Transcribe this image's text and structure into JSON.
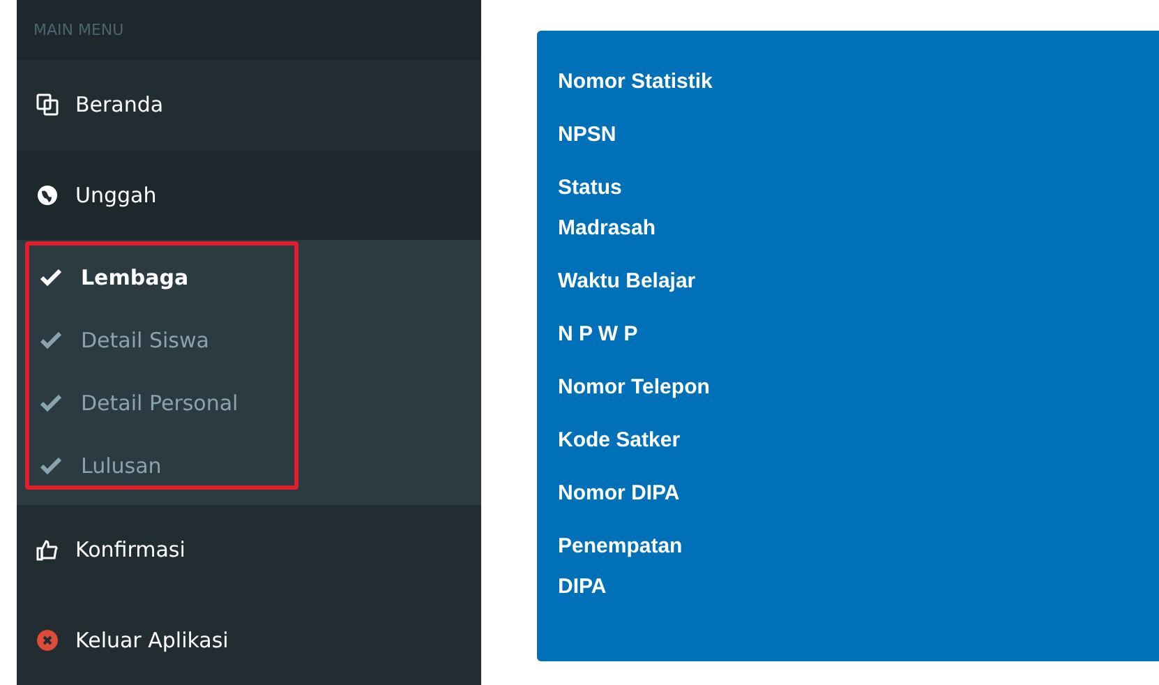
{
  "sidebar": {
    "header": "MAIN MENU",
    "items": [
      {
        "label": "Beranda",
        "expanded": false
      },
      {
        "label": "Unggah",
        "expanded": true,
        "children": [
          {
            "label": "Lembaga",
            "selected": true
          },
          {
            "label": "Detail Siswa",
            "selected": false
          },
          {
            "label": "Detail Personal",
            "selected": false
          },
          {
            "label": "Lulusan",
            "selected": false
          }
        ]
      },
      {
        "label": "Konfirmasi",
        "expanded": false
      },
      {
        "label": "Keluar Aplikasi",
        "expanded": false
      }
    ]
  },
  "panel": {
    "labels": [
      "Nomor Statistik",
      "NPSN",
      "Status\nMadrasah",
      "Waktu Belajar",
      "N P W P",
      "Nomor Telepon",
      "Kode Satker",
      "Nomor DIPA",
      "Penempatan\nDIPA"
    ]
  }
}
